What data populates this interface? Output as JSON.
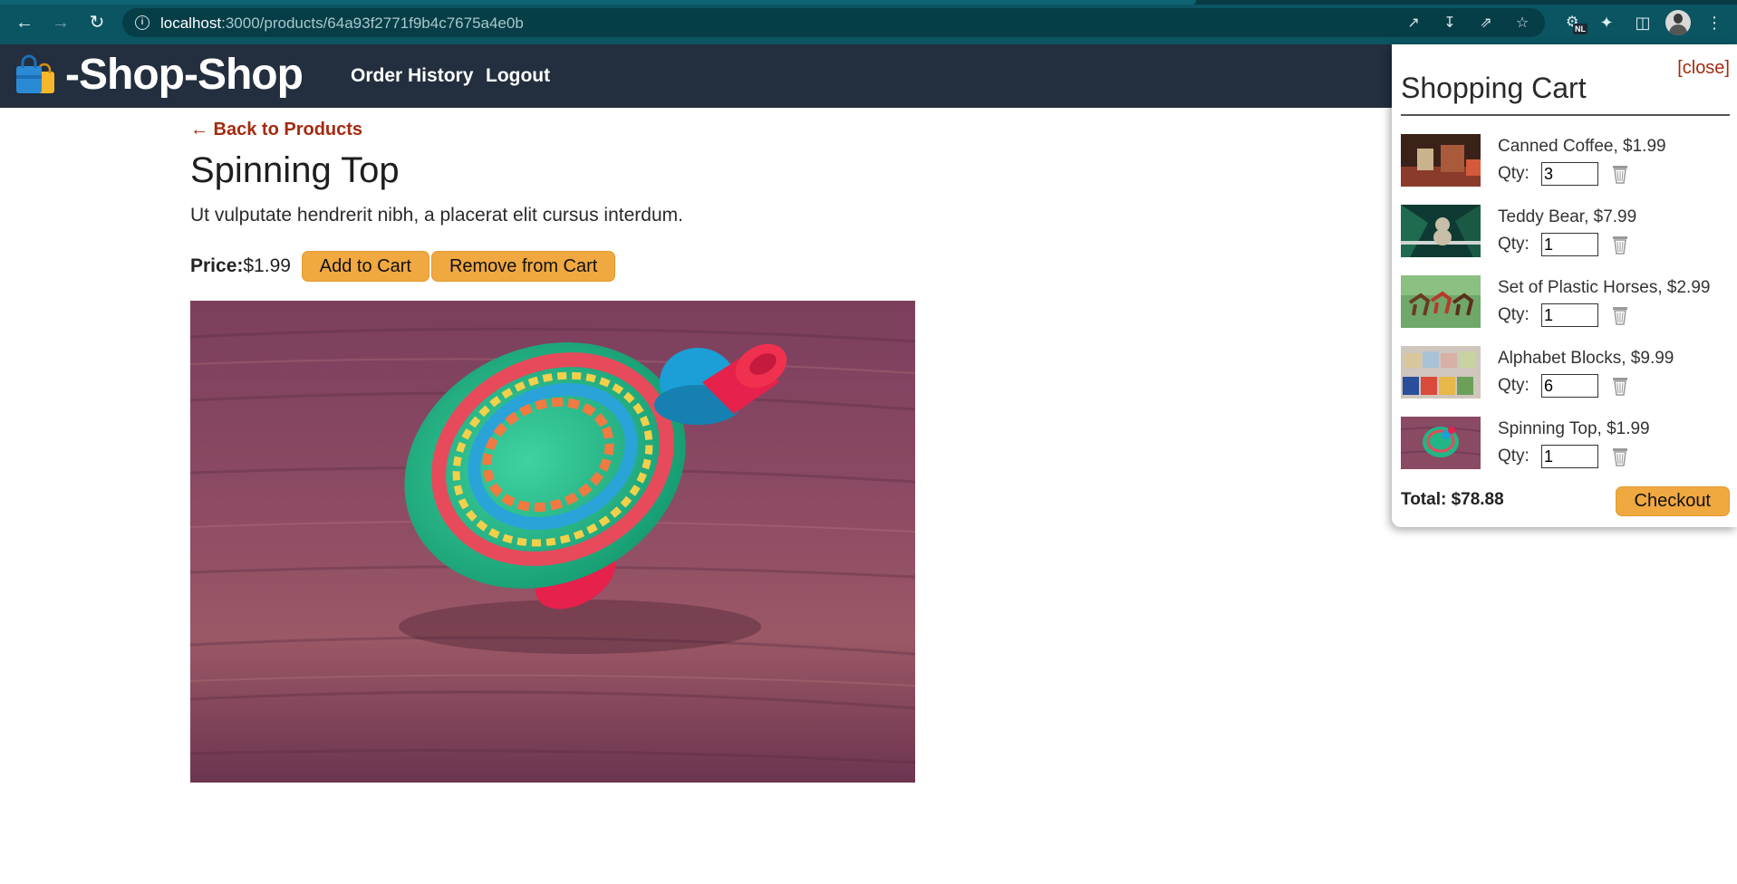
{
  "browser": {
    "url_host": "localhost",
    "url_path": ":3000/products/64a93f2771f9b4c7675a4e0b",
    "extension_badge": "NL"
  },
  "header": {
    "brand": "-Shop-Shop",
    "nav": {
      "order_history": "Order History",
      "logout": "Logout"
    }
  },
  "product": {
    "back_link": "← Back to Products",
    "title": "Spinning Top",
    "description": "Ut vulputate hendrerit nibh, a placerat elit cursus interdum.",
    "price_label": "Price:",
    "price": "$1.99",
    "add_label": "Add to Cart",
    "remove_label": "Remove from Cart"
  },
  "cart": {
    "close_label": "[close]",
    "title": "Shopping Cart",
    "qty_label": "Qty:",
    "items": [
      {
        "name": "Canned Coffee, $1.99",
        "qty": "3"
      },
      {
        "name": "Teddy Bear, $7.99",
        "qty": "1"
      },
      {
        "name": "Set of Plastic Horses, $2.99",
        "qty": "1"
      },
      {
        "name": "Alphabet Blocks, $9.99",
        "qty": "6"
      },
      {
        "name": "Spinning Top, $1.99",
        "qty": "1"
      }
    ],
    "total_label": "Total: $78.88",
    "checkout_label": "Checkout"
  },
  "colors": {
    "chrome": "#0b5461",
    "header": "#232f3e",
    "button": "#f0a840",
    "link": "#a52a0f"
  }
}
